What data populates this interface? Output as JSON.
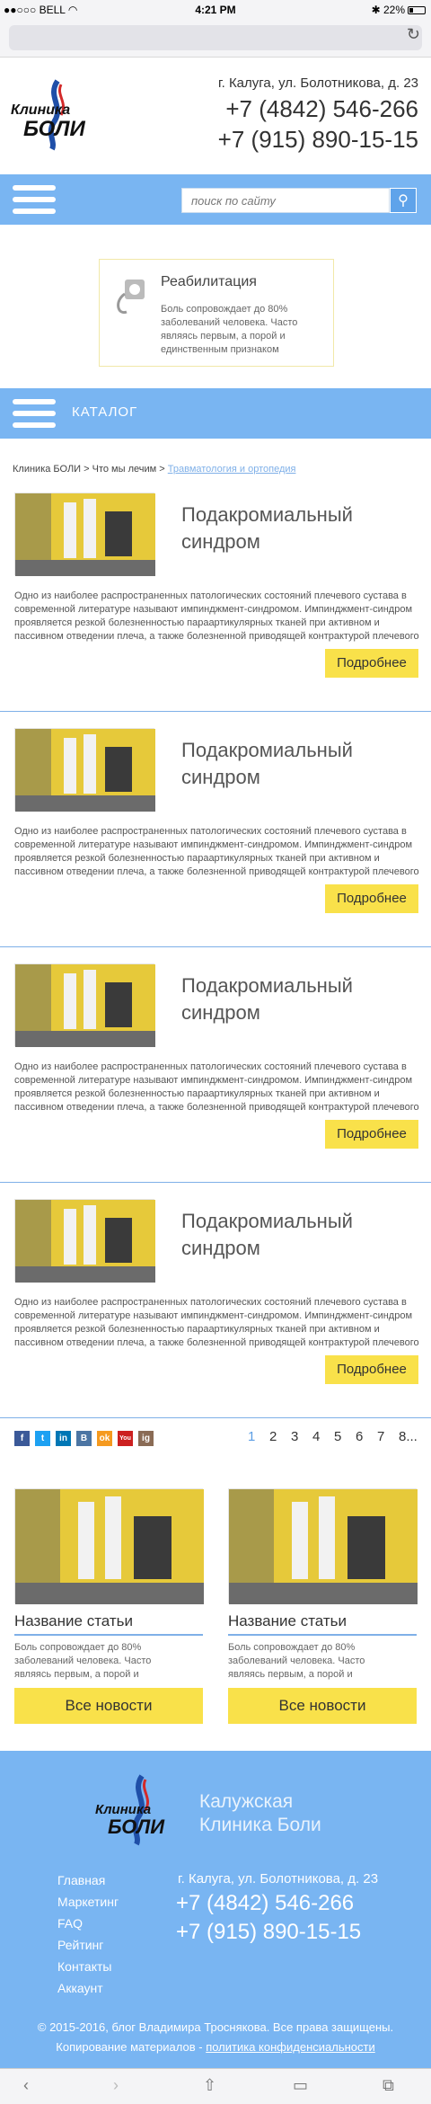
{
  "statusbar": {
    "carrier": "BELL",
    "time": "4:21 PM",
    "battery": "22%"
  },
  "header": {
    "logo_line1": "Клиника",
    "logo_line2": "БОЛИ",
    "address": "г. Калуга, ул. Болотникова, д. 23",
    "phone1": "+7 (4842) 546-266",
    "phone2": "+7 (915) 890-15-15"
  },
  "search": {
    "placeholder": "поиск по сайту"
  },
  "rehab": {
    "title": "Реабилитация",
    "desc": "Боль сопровождает до 80% заболеваний человека. Часто являясь первым, а порой и единственным признаком"
  },
  "catalog": {
    "label": "КАТАЛОГ"
  },
  "breadcrumb": {
    "item1": "Клиника БОЛИ",
    "sep": ">",
    "item2": "Что мы лечим",
    "item3": "Травматология и ортопедия"
  },
  "articles": [
    {
      "title": "Подакромиальный синдром",
      "text": "Одно из наиболее распространенных патологических состояний плечевого сустава в современной литературе называют импинджмент-синдромом. Импинджмент-синдром проявляется резкой болезненностью параартикулярных тканей при активном и пассивном отведении плеча, а также болезненной приводящей контрактурой плечевого сустава. Возникает такое",
      "more": "Подробнее"
    },
    {
      "title": "Подакромиальный синдром",
      "text": "Одно из наиболее распространенных патологических состояний плечевого сустава в современной литературе называют импинджмент-синдромом. Импинджмент-синдром проявляется резкой болезненностью параартикулярных тканей при активном и пассивном отведении плеча, а также болезненной приводящей контрактурой плечевого сустава. Возникает такое",
      "more": "Подробнее"
    },
    {
      "title": "Подакромиальный синдром",
      "text": "Одно из наиболее распространенных патологических состояний плечевого сустава в современной литературе называют импинджмент-синдромом. Импинджмент-синдром проявляется резкой болезненностью параартикулярных тканей при активном и пассивном отведении плеча, а также болезненной приводящей контрактурой плечевого сустава. Возникает такое",
      "more": "Подробнее"
    },
    {
      "title": "Подакромиальный синдром",
      "text": "Одно из наиболее распространенных патологических состояний плечевого сустава в современной литературе называют импинджмент-синдромом. Импинджмент-синдром проявляется резкой болезненностью параартикулярных тканей при активном и пассивном отведении плеча, а также болезненной приводящей контрактурой плечевого сустава. Возникает такое",
      "more": "Подробнее"
    }
  ],
  "social": {
    "facebook": "f",
    "twitter": "t",
    "linkedin": "in",
    "vk": "B",
    "odnoklassniki": "ok",
    "youtube": "You",
    "instagram": "ig"
  },
  "pager": {
    "p1": "1",
    "p2": "2",
    "p3": "3",
    "p4": "4",
    "p5": "5",
    "p6": "6",
    "p7": "7",
    "more": "8..."
  },
  "news": [
    {
      "title": "Название статьи",
      "desc": "Боль сопровождает до 80% заболеваний человека. Часто являясь первым, а порой и",
      "button": "Все новости"
    },
    {
      "title": "Название статьи",
      "desc": "Боль сопровождает до 80% заболеваний человека. Часто являясь первым, а порой и",
      "button": "Все новости"
    }
  ],
  "footer": {
    "name_line1": "Калужская",
    "name_line2": "Клиника Боли",
    "menu": [
      "Главная",
      "Маркетинг",
      "FAQ",
      "Рейтинг",
      "Контакты",
      "Аккаунт"
    ],
    "address": "г. Калуга, ул. Болотникова, д. 23",
    "phone1": "+7 (4842) 546-266",
    "phone2": "+7 (915) 890-15-15",
    "copyright": "© 2015-2016, блог Владимира Троснякова. Все права защищены.",
    "copy_text": "Копирование материалов -",
    "policy": "политика конфиденсиальности"
  },
  "colors": {
    "accent_blue": "#79b5f2",
    "button_yellow": "#f9e14a"
  }
}
